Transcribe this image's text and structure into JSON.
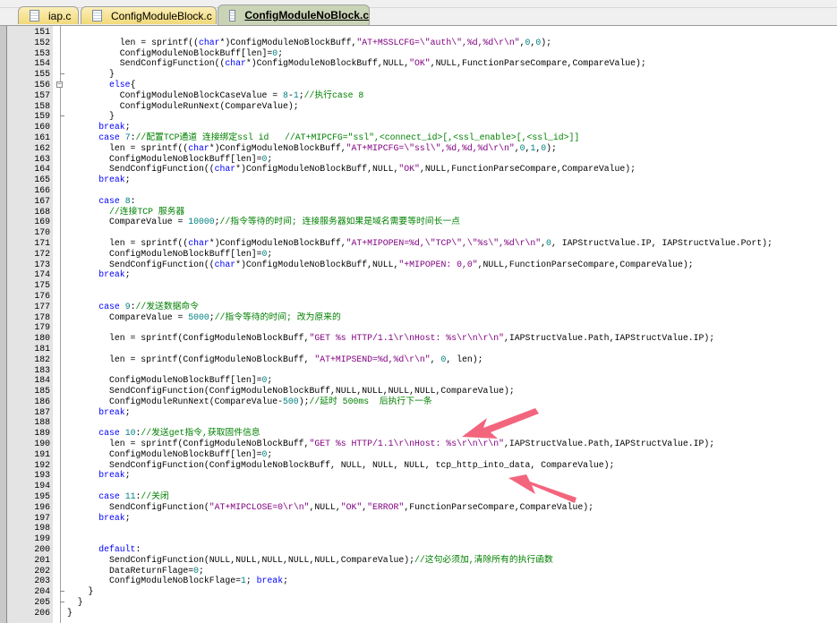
{
  "tabs": [
    {
      "label": "iap.c",
      "active": false
    },
    {
      "label": "ConfigModuleBlock.c",
      "active": false
    },
    {
      "label": "ConfigModuleNoBlock.c",
      "active": true
    }
  ],
  "colors": {
    "keyword": "#0000ff",
    "string": "#800080",
    "number": "#008080",
    "comment": "#008000",
    "arrow": "#f2546f"
  },
  "editor": {
    "fold_open_lines": [
      "156"
    ],
    "fold_end_lines": [
      "155",
      "159",
      "204",
      "205"
    ],
    "lines": [
      {
        "n": "151",
        "seg": []
      },
      {
        "n": "152",
        "seg": [
          [
            "t",
            "          len = sprintf(("
          ],
          [
            "k",
            "char"
          ],
          [
            "t",
            "*)ConfigModuleNoBlockBuff,"
          ],
          [
            "s",
            "\"AT+MSSLCFG=\\\"auth\\\",%d,%d\\r\\n\""
          ],
          [
            "t",
            ","
          ],
          [
            "n",
            "0"
          ],
          [
            "t",
            ","
          ],
          [
            "n",
            "0"
          ],
          [
            "t",
            ");"
          ]
        ]
      },
      {
        "n": "153",
        "seg": [
          [
            "t",
            "          ConfigModuleNoBlockBuff[len]="
          ],
          [
            "n",
            "0"
          ],
          [
            "t",
            ";"
          ]
        ]
      },
      {
        "n": "154",
        "seg": [
          [
            "t",
            "          SendConfigFunction(("
          ],
          [
            "k",
            "char"
          ],
          [
            "t",
            "*)ConfigModuleNoBlockBuff,NULL,"
          ],
          [
            "s",
            "\"OK\""
          ],
          [
            "t",
            ",NULL,FunctionParseCompare,CompareValue);"
          ]
        ]
      },
      {
        "n": "155",
        "seg": [
          [
            "t",
            "        }"
          ]
        ]
      },
      {
        "n": "156",
        "seg": [
          [
            "t",
            "        "
          ],
          [
            "k",
            "else"
          ],
          [
            "t",
            "{"
          ]
        ]
      },
      {
        "n": "157",
        "seg": [
          [
            "t",
            "          ConfigModuleNoBlockCaseValue = "
          ],
          [
            "n",
            "8"
          ],
          [
            "t",
            "-"
          ],
          [
            "n",
            "1"
          ],
          [
            "t",
            ";"
          ],
          [
            "c",
            "//执行case 8"
          ]
        ]
      },
      {
        "n": "158",
        "seg": [
          [
            "t",
            "          ConfigModuleRunNext(CompareValue);"
          ]
        ]
      },
      {
        "n": "159",
        "seg": [
          [
            "t",
            "        }"
          ]
        ]
      },
      {
        "n": "160",
        "seg": [
          [
            "t",
            "      "
          ],
          [
            "k",
            "break"
          ],
          [
            "t",
            ";"
          ]
        ]
      },
      {
        "n": "161",
        "seg": [
          [
            "t",
            "      "
          ],
          [
            "k",
            "case"
          ],
          [
            "t",
            " "
          ],
          [
            "n",
            "7"
          ],
          [
            "t",
            ":"
          ],
          [
            "c",
            "//配置TCP通道 连接绑定ssl id   //AT+MIPCFG=\"ssl\",<connect_id>[,<ssl_enable>[,<ssl_id>]]"
          ]
        ]
      },
      {
        "n": "162",
        "seg": [
          [
            "t",
            "        len = sprintf(("
          ],
          [
            "k",
            "char"
          ],
          [
            "t",
            "*)ConfigModuleNoBlockBuff,"
          ],
          [
            "s",
            "\"AT+MIPCFG=\\\"ssl\\\",%d,%d,%d\\r\\n\""
          ],
          [
            "t",
            ","
          ],
          [
            "n",
            "0"
          ],
          [
            "t",
            ","
          ],
          [
            "n",
            "1"
          ],
          [
            "t",
            ","
          ],
          [
            "n",
            "0"
          ],
          [
            "t",
            ");"
          ]
        ]
      },
      {
        "n": "163",
        "seg": [
          [
            "t",
            "        ConfigModuleNoBlockBuff[len]="
          ],
          [
            "n",
            "0"
          ],
          [
            "t",
            ";"
          ]
        ]
      },
      {
        "n": "164",
        "seg": [
          [
            "t",
            "        SendConfigFunction(("
          ],
          [
            "k",
            "char"
          ],
          [
            "t",
            "*)ConfigModuleNoBlockBuff,NULL,"
          ],
          [
            "s",
            "\"OK\""
          ],
          [
            "t",
            ",NULL,FunctionParseCompare,CompareValue);"
          ]
        ]
      },
      {
        "n": "165",
        "seg": [
          [
            "t",
            "      "
          ],
          [
            "k",
            "break"
          ],
          [
            "t",
            ";"
          ]
        ]
      },
      {
        "n": "166",
        "seg": []
      },
      {
        "n": "167",
        "seg": [
          [
            "t",
            "      "
          ],
          [
            "k",
            "case"
          ],
          [
            "t",
            " "
          ],
          [
            "n",
            "8"
          ],
          [
            "t",
            ":"
          ]
        ]
      },
      {
        "n": "168",
        "seg": [
          [
            "t",
            "        "
          ],
          [
            "c",
            "//连接TCP 服务器"
          ]
        ]
      },
      {
        "n": "169",
        "seg": [
          [
            "t",
            "        CompareValue = "
          ],
          [
            "n",
            "10000"
          ],
          [
            "t",
            ";"
          ],
          [
            "c",
            "//指令等待的时间; 连接服务器如果是域名需要等时间长一点"
          ]
        ]
      },
      {
        "n": "170",
        "seg": []
      },
      {
        "n": "171",
        "seg": [
          [
            "t",
            "        len = sprintf(("
          ],
          [
            "k",
            "char"
          ],
          [
            "t",
            "*)ConfigModuleNoBlockBuff,"
          ],
          [
            "s",
            "\"AT+MIPOPEN=%d,\\\"TCP\\\",\\\"%s\\\",%d\\r\\n\""
          ],
          [
            "t",
            ","
          ],
          [
            "n",
            "0"
          ],
          [
            "t",
            ", IAPStructValue.IP, IAPStructValue.Port);"
          ]
        ]
      },
      {
        "n": "172",
        "seg": [
          [
            "t",
            "        ConfigModuleNoBlockBuff[len]="
          ],
          [
            "n",
            "0"
          ],
          [
            "t",
            ";"
          ]
        ]
      },
      {
        "n": "173",
        "seg": [
          [
            "t",
            "        SendConfigFunction(("
          ],
          [
            "k",
            "char"
          ],
          [
            "t",
            "*)ConfigModuleNoBlockBuff,NULL,"
          ],
          [
            "s",
            "\"+MIPOPEN: 0,0\""
          ],
          [
            "t",
            ",NULL,FunctionParseCompare,CompareValue);"
          ]
        ]
      },
      {
        "n": "174",
        "seg": [
          [
            "t",
            "      "
          ],
          [
            "k",
            "break"
          ],
          [
            "t",
            ";"
          ]
        ]
      },
      {
        "n": "175",
        "seg": []
      },
      {
        "n": "176",
        "seg": []
      },
      {
        "n": "177",
        "seg": [
          [
            "t",
            "      "
          ],
          [
            "k",
            "case"
          ],
          [
            "t",
            " "
          ],
          [
            "n",
            "9"
          ],
          [
            "t",
            ":"
          ],
          [
            "c",
            "//发送数据命令"
          ]
        ]
      },
      {
        "n": "178",
        "seg": [
          [
            "t",
            "        CompareValue = "
          ],
          [
            "n",
            "5000"
          ],
          [
            "t",
            ";"
          ],
          [
            "c",
            "//指令等待的时间; 改为原来的"
          ]
        ]
      },
      {
        "n": "179",
        "seg": []
      },
      {
        "n": "180",
        "seg": [
          [
            "t",
            "        len = sprintf(ConfigModuleNoBlockBuff,"
          ],
          [
            "s",
            "\"GET %s HTTP/1.1\\r\\nHost: %s\\r\\n\\r\\n\""
          ],
          [
            "t",
            ",IAPStructValue.Path,IAPStructValue.IP);"
          ]
        ]
      },
      {
        "n": "181",
        "seg": []
      },
      {
        "n": "182",
        "seg": [
          [
            "t",
            "        len = sprintf(ConfigModuleNoBlockBuff, "
          ],
          [
            "s",
            "\"AT+MIPSEND=%d,%d\\r\\n\""
          ],
          [
            "t",
            ", "
          ],
          [
            "n",
            "0"
          ],
          [
            "t",
            ", len);"
          ]
        ]
      },
      {
        "n": "183",
        "seg": []
      },
      {
        "n": "184",
        "seg": [
          [
            "t",
            "        ConfigModuleNoBlockBuff[len]="
          ],
          [
            "n",
            "0"
          ],
          [
            "t",
            ";"
          ]
        ]
      },
      {
        "n": "185",
        "seg": [
          [
            "t",
            "        SendConfigFunction(ConfigModuleNoBlockBuff,NULL,NULL,NULL,NULL,CompareValue);"
          ]
        ]
      },
      {
        "n": "186",
        "seg": [
          [
            "t",
            "        ConfigModuleRunNext(CompareValue-"
          ],
          [
            "n",
            "500"
          ],
          [
            "t",
            ");"
          ],
          [
            "c",
            "//延时 500ms  后执行下一条"
          ]
        ]
      },
      {
        "n": "187",
        "seg": [
          [
            "t",
            "      "
          ],
          [
            "k",
            "break"
          ],
          [
            "t",
            ";"
          ]
        ]
      },
      {
        "n": "188",
        "seg": []
      },
      {
        "n": "189",
        "seg": [
          [
            "t",
            "      "
          ],
          [
            "k",
            "case"
          ],
          [
            "t",
            " "
          ],
          [
            "n",
            "10"
          ],
          [
            "t",
            ":"
          ],
          [
            "c",
            "//发送get指令,获取固件信息"
          ]
        ]
      },
      {
        "n": "190",
        "seg": [
          [
            "t",
            "        len = sprintf(ConfigModuleNoBlockBuff,"
          ],
          [
            "s",
            "\"GET %s HTTP/1.1\\r\\nHost: %s\\r\\n\\r\\n\""
          ],
          [
            "t",
            ",IAPStructValue.Path,IAPStructValue.IP);"
          ]
        ]
      },
      {
        "n": "191",
        "seg": [
          [
            "t",
            "        ConfigModuleNoBlockBuff[len]="
          ],
          [
            "n",
            "0"
          ],
          [
            "t",
            ";"
          ]
        ]
      },
      {
        "n": "192",
        "seg": [
          [
            "t",
            "        SendConfigFunction(ConfigModuleNoBlockBuff, NULL, NULL, NULL, tcp_http_into_data, CompareValue);"
          ]
        ]
      },
      {
        "n": "193",
        "seg": [
          [
            "t",
            "      "
          ],
          [
            "k",
            "break"
          ],
          [
            "t",
            ";"
          ]
        ]
      },
      {
        "n": "194",
        "seg": []
      },
      {
        "n": "195",
        "seg": [
          [
            "t",
            "      "
          ],
          [
            "k",
            "case"
          ],
          [
            "t",
            " "
          ],
          [
            "n",
            "11"
          ],
          [
            "t",
            ":"
          ],
          [
            "c",
            "//关闭"
          ]
        ]
      },
      {
        "n": "196",
        "seg": [
          [
            "t",
            "        SendConfigFunction("
          ],
          [
            "s",
            "\"AT+MIPCLOSE=0\\r\\n\""
          ],
          [
            "t",
            ",NULL,"
          ],
          [
            "s",
            "\"OK\""
          ],
          [
            "t",
            ","
          ],
          [
            "s",
            "\"ERROR\""
          ],
          [
            "t",
            ",FunctionParseCompare,CompareValue);"
          ]
        ]
      },
      {
        "n": "197",
        "seg": [
          [
            "t",
            "      "
          ],
          [
            "k",
            "break"
          ],
          [
            "t",
            ";"
          ]
        ]
      },
      {
        "n": "198",
        "seg": []
      },
      {
        "n": "199",
        "seg": []
      },
      {
        "n": "200",
        "seg": [
          [
            "t",
            "      "
          ],
          [
            "k",
            "default"
          ],
          [
            "t",
            ":"
          ]
        ]
      },
      {
        "n": "201",
        "seg": [
          [
            "t",
            "        SendConfigFunction(NULL,NULL,NULL,NULL,NULL,CompareValue);"
          ],
          [
            "c",
            "//这句必须加,清除所有的执行函数"
          ]
        ]
      },
      {
        "n": "202",
        "seg": [
          [
            "t",
            "        DataReturnFlage="
          ],
          [
            "n",
            "0"
          ],
          [
            "t",
            ";"
          ]
        ]
      },
      {
        "n": "203",
        "seg": [
          [
            "t",
            "        ConfigModuleNoBlockFlage="
          ],
          [
            "n",
            "1"
          ],
          [
            "t",
            "; "
          ],
          [
            "k",
            "break"
          ],
          [
            "t",
            ";"
          ]
        ]
      },
      {
        "n": "204",
        "seg": [
          [
            "t",
            "    }"
          ]
        ]
      },
      {
        "n": "205",
        "seg": [
          [
            "t",
            "  }"
          ]
        ]
      },
      {
        "n": "206",
        "seg": [
          [
            "t",
            "}"
          ]
        ]
      }
    ]
  }
}
